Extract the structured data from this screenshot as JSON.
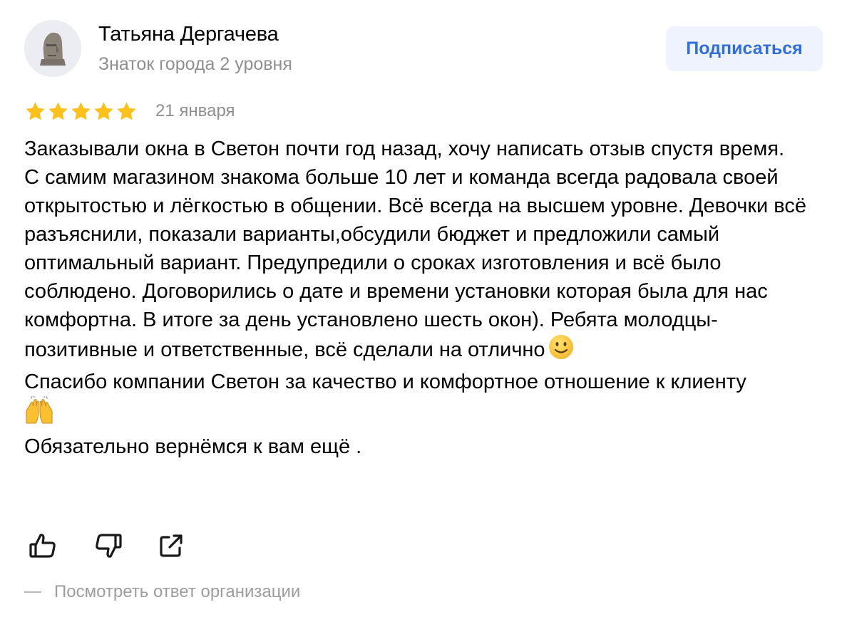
{
  "author": {
    "name": "Татьяна Дергачева",
    "level": "Знаток города 2 уровня",
    "avatar_icon": "moai-statue-icon"
  },
  "subscribe_label": "Подписаться",
  "rating": {
    "value": 5,
    "max": 5,
    "star_color": "#fcc21b"
  },
  "date": "21 января",
  "review": {
    "lines": [
      "Заказывали окна в Светон почти год назад, хочу написать отзыв спустя время.",
      "С самим магазином знакома больше 10 лет и команда всегда радовала своей открытостью и лёгкостью в общении. Всё всегда на высшем уровне. Девочки всё разъяснили, показали варианты,обсудили бюджет и предложили самый оптимальный вариант. Предупредили о сроках изготовления и всё было соблюдено. Договорились о дате и времени установки которая была для нас комфортна. В итоге за день установлено шесть окон). Ребята молодцы- позитивные и ответственные, всё сделали на отлично",
      "Спасибо компании Светон за качество и комфортное отношение к клиенту",
      "Обязательно вернёмся к вам ещё ."
    ],
    "emojis": [
      "slightly-smiling-face-emoji",
      "raising-hands-emoji"
    ]
  },
  "actions": {
    "like_icon": "thumbs-up-icon",
    "dislike_icon": "thumbs-down-icon",
    "share_icon": "share-icon"
  },
  "org_reply_label": "Посмотреть ответ организации",
  "colors": {
    "accent": "#2f6edb",
    "subscribe_bg": "#eef3fd",
    "muted_text": "#8f8f8f"
  }
}
